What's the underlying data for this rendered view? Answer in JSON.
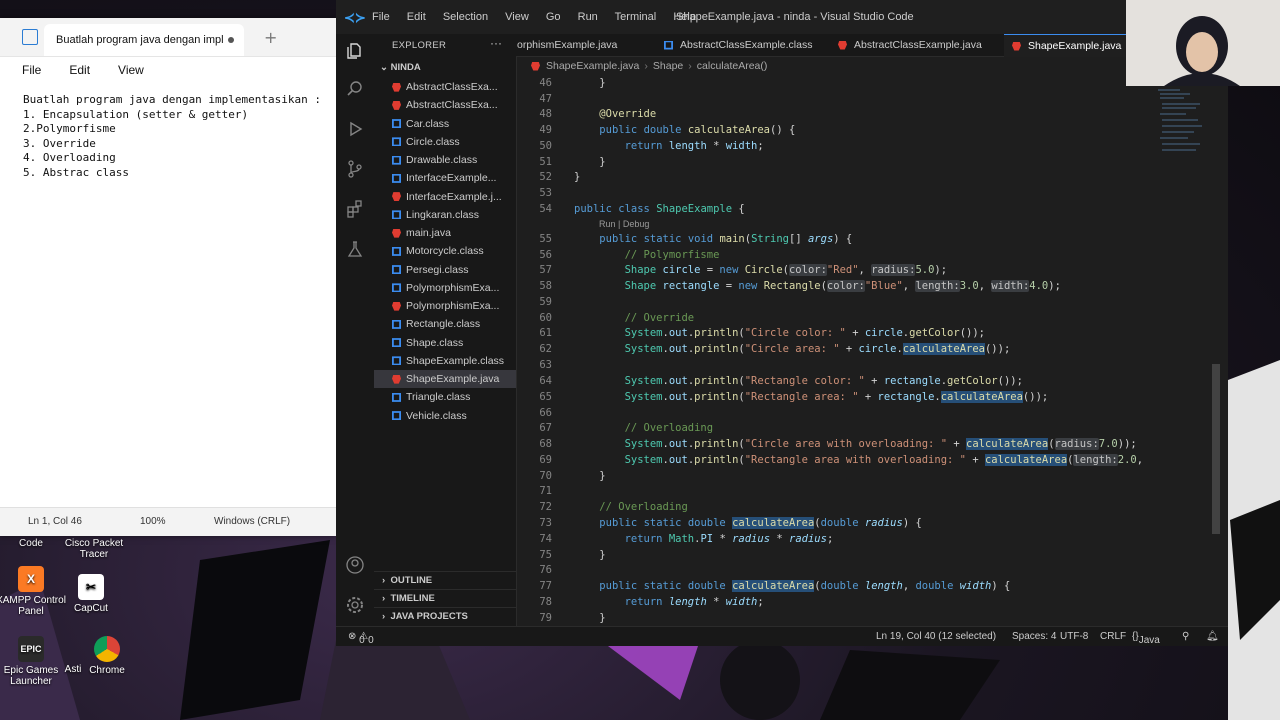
{
  "desktop": {
    "icons": [
      {
        "label": "Code"
      },
      {
        "label": "Cisco Packet Tracer"
      },
      {
        "label": "XAMPP Control Panel"
      },
      {
        "label": "CapCut"
      },
      {
        "label": "Epic Games Launcher"
      },
      {
        "label": "Asti"
      },
      {
        "label": "Chrome"
      }
    ]
  },
  "notepad": {
    "tab_title": "Buatlah program java dengan impl",
    "menu": [
      "File",
      "Edit",
      "View"
    ],
    "lines": [
      "Buatlah program java dengan implementasikan :",
      "1. Encapsulation (setter & getter)",
      "2.Polymorfisme",
      "3. Override",
      "4. Overloading",
      "5. Abstrac class"
    ],
    "status": {
      "position": "Ln 1, Col 46",
      "zoom": "100%",
      "eol": "Windows (CRLF)"
    }
  },
  "vscode": {
    "menu": [
      "File",
      "Edit",
      "Selection",
      "View",
      "Go",
      "Run",
      "Terminal",
      "Help"
    ],
    "window_title": "ShapeExample.java - ninda - Visual Studio Code",
    "explorer": {
      "header": "EXPLORER",
      "folder": "NINDA",
      "files": [
        {
          "name": "AbstractClassExa...",
          "type": "java"
        },
        {
          "name": "AbstractClassExa...",
          "type": "java"
        },
        {
          "name": "Car.class",
          "type": "cls"
        },
        {
          "name": "Circle.class",
          "type": "cls"
        },
        {
          "name": "Drawable.class",
          "type": "cls"
        },
        {
          "name": "InterfaceExample...",
          "type": "cls"
        },
        {
          "name": "InterfaceExample.j...",
          "type": "java"
        },
        {
          "name": "Lingkaran.class",
          "type": "cls"
        },
        {
          "name": "main.java",
          "type": "java"
        },
        {
          "name": "Motorcycle.class",
          "type": "cls"
        },
        {
          "name": "Persegi.class",
          "type": "cls"
        },
        {
          "name": "PolymorphismExa...",
          "type": "cls"
        },
        {
          "name": "PolymorphismExa...",
          "type": "java"
        },
        {
          "name": "Rectangle.class",
          "type": "cls"
        },
        {
          "name": "Shape.class",
          "type": "cls"
        },
        {
          "name": "ShapeExample.class",
          "type": "cls"
        },
        {
          "name": "ShapeExample.java",
          "type": "java"
        },
        {
          "name": "Triangle.class",
          "type": "cls"
        },
        {
          "name": "Vehicle.class",
          "type": "cls"
        }
      ],
      "sections": [
        "OUTLINE",
        "TIMELINE",
        "JAVA PROJECTS"
      ]
    },
    "tabs": [
      "orphismExample.java",
      "AbstractClassExample.class",
      "AbstractClassExample.java",
      "ShapeExample.java"
    ],
    "breadcrumbs": [
      "ShapeExample.java",
      "Shape",
      "calculateArea()"
    ],
    "codelens": "Run | Debug",
    "line_numbers": [
      "46",
      "47",
      "48",
      "49",
      "50",
      "51",
      "52",
      "53",
      "54",
      "55",
      "56",
      "57",
      "58",
      "59",
      "60",
      "61",
      "62",
      "63",
      "64",
      "65",
      "66",
      "67",
      "68",
      "69",
      "70",
      "71",
      "72",
      "73",
      "74",
      "75",
      "76",
      "77",
      "78",
      "79"
    ],
    "status": {
      "problems": "0",
      "warnings": "0",
      "cursor": "Ln 19, Col 40 (12 selected)",
      "spaces": "Spaces: 4",
      "encoding": "UTF-8",
      "eol": "CRLF",
      "language": "Java"
    }
  }
}
